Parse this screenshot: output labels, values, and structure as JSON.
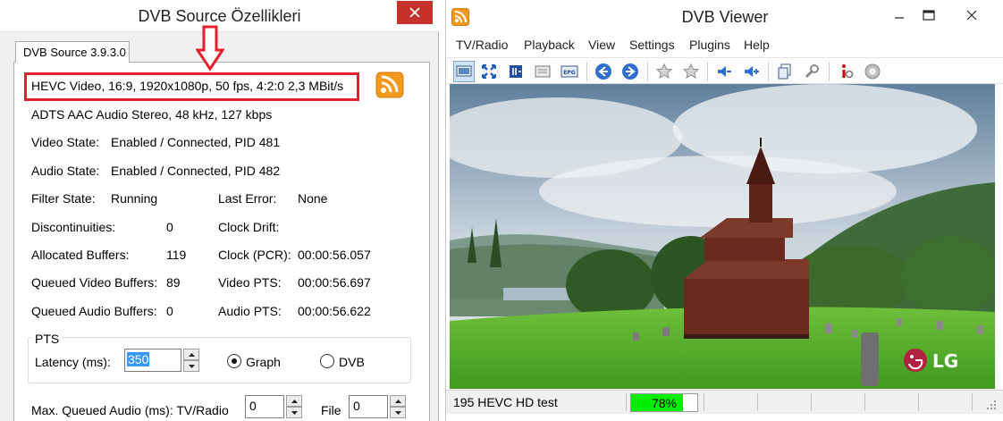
{
  "left_window": {
    "title": "DVB Source Özellikleri",
    "tab_label": "DVB Source 3.9.3.0",
    "video_info": "HEVC Video, 16:9, 1920x1080p, 50 fps, 4:2:0   2,3 MBit/s",
    "audio_info": "ADTS AAC Audio Stereo, 48 kHz, 127 kbps",
    "video_state": {
      "label": "Video State:",
      "value": "Enabled / Connected, PID 481"
    },
    "audio_state": {
      "label": "Audio State:",
      "value": "Enabled / Connected, PID 482"
    },
    "filter_state": {
      "label": "Filter State:",
      "value": "Running"
    },
    "last_error": {
      "label": "Last Error:",
      "value": "None"
    },
    "discontinuities": {
      "label": "Discontinuities:",
      "value": "0"
    },
    "clock_drift": {
      "label": "Clock Drift:",
      "value": ""
    },
    "allocated_buffers": {
      "label": "Allocated Buffers:",
      "value": "119"
    },
    "clock_pcr": {
      "label": "Clock (PCR):",
      "value": "00:00:56.057"
    },
    "queued_video": {
      "label": "Queued Video Buffers:",
      "value": "89"
    },
    "video_pts": {
      "label": "Video PTS:",
      "value": "00:00:56.697"
    },
    "queued_audio": {
      "label": "Queued Audio Buffers:",
      "value": "0"
    },
    "audio_pts": {
      "label": "Audio PTS:",
      "value": "00:00:56.622"
    },
    "pts": {
      "group_label": "PTS",
      "latency_label": "Latency (ms):",
      "latency_value": "350",
      "graph_label": "Graph",
      "dvb_label": "DVB",
      "selected": "Graph"
    },
    "max_queued": {
      "label": "Max. Queued Audio (ms): TV/Radio",
      "tvradio_value": "0",
      "file_label": "File",
      "file_value": "0"
    },
    "colors": {
      "highlight": "#e3202d",
      "close_button": "#c7312b"
    }
  },
  "right_window": {
    "title": "DVB Viewer",
    "menu": [
      "TV/Radio",
      "Playback",
      "View",
      "Settings",
      "Plugins",
      "Help"
    ],
    "toolbar_icons": [
      "monitor-icon",
      "fullscreen-icon",
      "teletext-icon",
      "osd-icon",
      "epg-icon",
      "back-icon",
      "forward-icon",
      "favorite-icon",
      "favorite-add-icon",
      "volume-down-icon",
      "volume-up-icon",
      "copy-icon",
      "tools-icon",
      "info-icon",
      "record-icon"
    ],
    "epg_icon_text": "EPG",
    "video_logo_text": "LG",
    "status_text": "195 HEVC HD test",
    "signal_percent": 78,
    "signal_text": "78%",
    "colors": {
      "signal_fill": "#00f000"
    }
  }
}
